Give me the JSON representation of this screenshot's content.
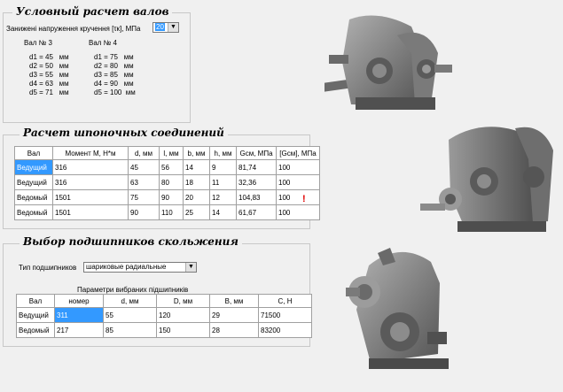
{
  "shafts_group": {
    "title": "Условный расчет валов",
    "stress_label": "Занижені напруження кручення [τк], МПа",
    "stress_value": "20",
    "shaft3_label": "Вал № 3",
    "shaft4_label": "Вал № 4",
    "shaft3": [
      "d1 = 45   мм",
      "d2 = 50   мм",
      "d3 = 55   мм",
      "d4 = 63   мм",
      "d5 = 71   мм"
    ],
    "shaft4": [
      "d1 = 75   мм",
      "d2 = 80   мм",
      "d3 = 85   мм",
      "d4 = 90   мм",
      "d5 = 100  мм"
    ]
  },
  "keys_group": {
    "title": "Расчет шпоночных соединений",
    "headers": [
      "Вал",
      "Момент М, Н*м",
      "d, мм",
      "l, мм",
      "b, мм",
      "h, мм",
      "Gсм, МПа",
      "[Gсм], МПа"
    ],
    "rows": [
      [
        "Ведущий",
        "316",
        "45",
        "56",
        "14",
        "9",
        "81,74",
        "100"
      ],
      [
        "Ведущий",
        "316",
        "63",
        "80",
        "18",
        "11",
        "32,36",
        "100"
      ],
      [
        "Ведомый",
        "1501",
        "75",
        "90",
        "20",
        "12",
        "104,83",
        "100"
      ],
      [
        "Ведомый",
        "1501",
        "90",
        "110",
        "25",
        "14",
        "61,67",
        "100"
      ]
    ],
    "warning": "!"
  },
  "bearings_group": {
    "title": "Выбор подшипников скольжения",
    "type_label": "Тип подшипников",
    "type_value": "шариковые радиальные",
    "params_caption": "Параметри вибраних підшипників",
    "headers": [
      "Вал",
      "номер",
      "d, мм",
      "D, мм",
      "B, мм",
      "C, H"
    ],
    "rows": [
      [
        "Ведущий",
        "311",
        "55",
        "120",
        "29",
        "71500"
      ],
      [
        "Ведомый",
        "217",
        "85",
        "150",
        "28",
        "83200"
      ]
    ]
  },
  "colors": {
    "selection": "#3399ff",
    "warning": "#e00000",
    "gearbox": "#8a8a8a"
  }
}
